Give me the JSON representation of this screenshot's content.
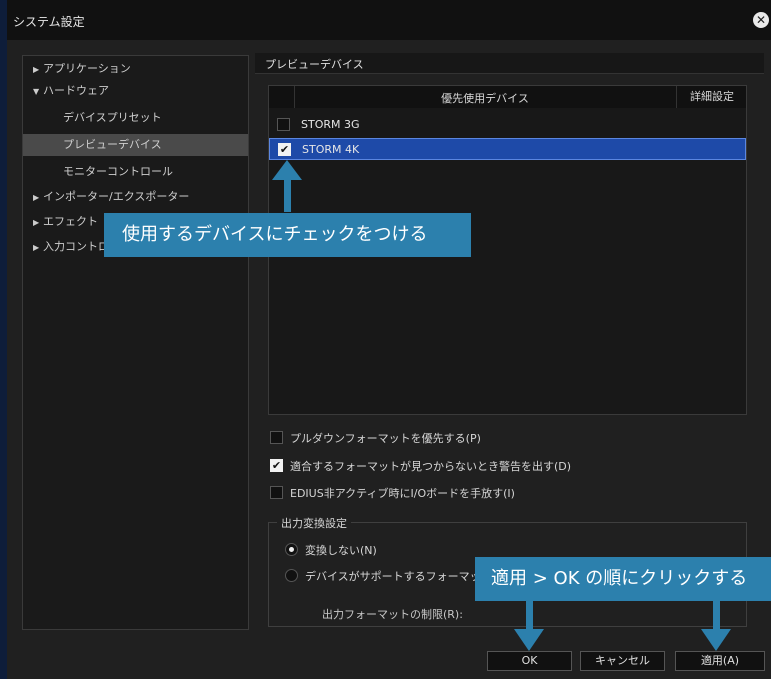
{
  "window": {
    "title": "システム設定"
  },
  "tree": {
    "items": [
      {
        "label": "アプリケーション",
        "arrow": "▶"
      },
      {
        "label": "ハードウェア",
        "arrow": "▼"
      },
      {
        "label": "デバイスプリセット",
        "arrow": ""
      },
      {
        "label": "プレビューデバイス",
        "arrow": "",
        "selected": true
      },
      {
        "label": "モニターコントロール",
        "arrow": ""
      },
      {
        "label": "インポーター/エクスポーター",
        "arrow": "▶"
      },
      {
        "label": "エフェクト",
        "arrow": "▶"
      },
      {
        "label": "入力コントローラー",
        "arrow": "▶"
      }
    ]
  },
  "section": {
    "title": "プレビューデバイス"
  },
  "device_list": {
    "headers": {
      "priority": "優先使用デバイス",
      "details": "詳細設定"
    },
    "rows": [
      {
        "name": "STORM 3G",
        "checked": false
      },
      {
        "name": "STORM 4K",
        "checked": true
      }
    ]
  },
  "options": {
    "pulldown": "プルダウンフォーマットを優先する(P)",
    "warn": "適合するフォーマットが見つからないとき警告を出す(D)",
    "release": "EDIUS非アクティブ時にI/Oボードを手放す(I)"
  },
  "output_group": {
    "label": "出力変換設定",
    "no_convert": "変換しない(N)",
    "device_supported": "デバイスがサポートするフォーマット",
    "format_limit": "出力フォーマットの制限(R):"
  },
  "buttons": {
    "ok": "OK",
    "cancel": "キャンセル",
    "apply": "適用(A)"
  },
  "annotations": {
    "check_hint": "使用するデバイスにチェックをつける",
    "apply_hint": "適用 > OK の順にクリックする"
  },
  "colors": {
    "accent": "#2c80ad",
    "selection": "#1e4aa8"
  }
}
